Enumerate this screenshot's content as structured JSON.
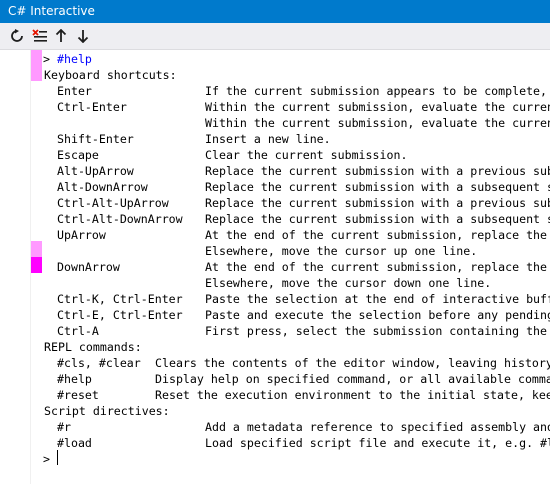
{
  "window": {
    "title": "C# Interactive"
  },
  "toolbar": {
    "buttons": [
      {
        "name": "reset-button",
        "icon": "reset-icon"
      },
      {
        "name": "clear-button",
        "icon": "clear-screen-icon"
      },
      {
        "name": "history-previous-button",
        "icon": "arrow-up-icon"
      },
      {
        "name": "history-next-button",
        "icon": "arrow-down-icon"
      }
    ]
  },
  "colors": {
    "accent": "#007acc",
    "command": "#0000ff",
    "marker_light": "#ff99ff",
    "marker_strong": "#ff00ff"
  },
  "prompt_symbol": ">",
  "command": "#help",
  "output": {
    "kb_header": "Keyboard shortcuts:",
    "kb": [
      {
        "key": "Enter",
        "desc": "If the current submission appears to be complete, evaluate it.  Otherwise, insert a new line."
      },
      {
        "key": "Ctrl-Enter",
        "desc": "Within the current submission, evaluate the current submission."
      },
      {
        "key": "",
        "desc": "Within the current submission, evaluate the current submission."
      },
      {
        "key": "Shift-Enter",
        "desc": "Insert a new line."
      },
      {
        "key": "Escape",
        "desc": "Clear the current submission."
      },
      {
        "key": "Alt-UpArrow",
        "desc": "Replace the current submission with a previous submission."
      },
      {
        "key": "Alt-DownArrow",
        "desc": "Replace the current submission with a subsequent submission."
      },
      {
        "key": "Ctrl-Alt-UpArrow",
        "desc": "Replace the current submission with a previous submission."
      },
      {
        "key": "Ctrl-Alt-DownArrow",
        "desc": "Replace the current submission with a subsequent submission."
      },
      {
        "key": "UpArrow",
        "desc": "At the end of the current submission, replace the current submission with a previous submission."
      },
      {
        "key": "",
        "desc": "Elsewhere, move the cursor up one line."
      },
      {
        "key": "DownArrow",
        "desc": "At the end of the current submission, replace the current submission with a subsequent submission."
      },
      {
        "key": "",
        "desc": "Elsewhere, move the cursor down one line."
      },
      {
        "key": "Ctrl-K, Ctrl-Enter",
        "desc": "Paste the selection at the end of interactive buffer, leave caret at the end of input."
      },
      {
        "key": "Ctrl-E, Ctrl-Enter",
        "desc": "Paste and execute the selection before any pending input in the interactive buffer."
      },
      {
        "key": "Ctrl-A",
        "desc": "First press, select the submission containing the cursor.  Second press, select all text."
      }
    ],
    "repl_header": "REPL commands:",
    "repl": [
      {
        "key": "#cls, #clear",
        "desc": "Clears the contents of the editor window, leaving history and execution context intact."
      },
      {
        "key": "#help",
        "desc": "Display help on specified command, or all available commands and key bindings if none specified."
      },
      {
        "key": "#reset",
        "desc": "Reset the execution environment to the initial state, keep history."
      }
    ],
    "script_header": "Script directives:",
    "script": [
      {
        "key": "#r",
        "desc": "Add a metadata reference to specified assembly and all its dependencies, e.g. #r \"myLib.dll\"."
      },
      {
        "key": "#load",
        "desc": "Load specified script file and execute it, e.g. #load \"myScript.csx\"."
      }
    ]
  }
}
